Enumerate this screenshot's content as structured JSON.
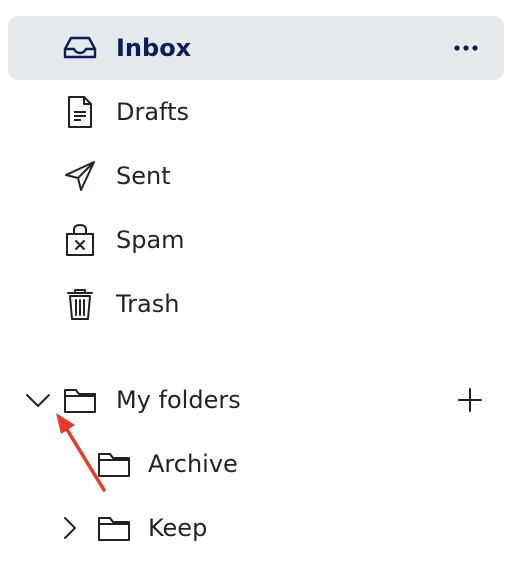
{
  "nav": {
    "inbox": {
      "label": "Inbox",
      "icon": "inbox-icon"
    },
    "drafts": {
      "label": "Drafts",
      "icon": "draft-document-icon"
    },
    "sent": {
      "label": "Sent",
      "icon": "send-icon"
    },
    "spam": {
      "label": "Spam",
      "icon": "spam-bag-icon"
    },
    "trash": {
      "label": "Trash",
      "icon": "trash-icon"
    }
  },
  "folders": {
    "section_label": "My folders",
    "items": [
      {
        "label": "Archive",
        "expanded": false,
        "has_children": false
      },
      {
        "label": "Keep",
        "expanded": false,
        "has_children": true
      }
    ]
  },
  "colors": {
    "active_bg": "#e6e9ec",
    "active_text": "#0b1e5b",
    "text": "#1f2329",
    "annotation_arrow": "#e8392a"
  }
}
